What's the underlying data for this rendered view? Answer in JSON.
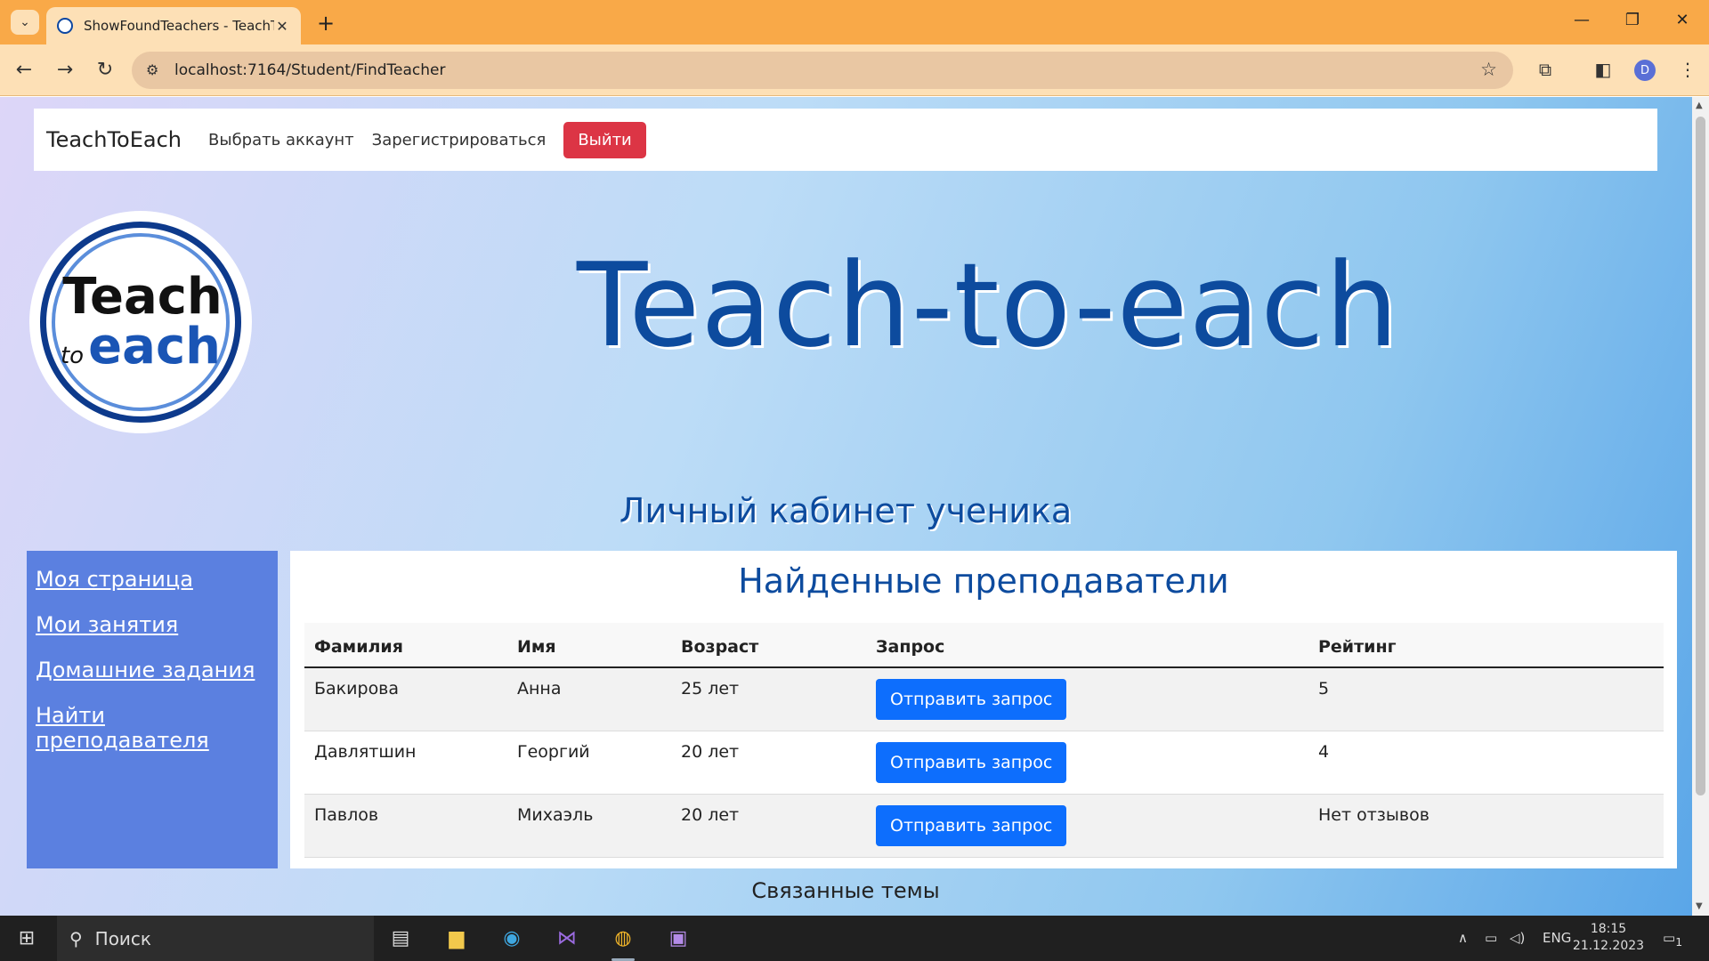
{
  "browser": {
    "tab_title": "ShowFoundTeachers - TeachToE",
    "tab_close": "✕",
    "new_tab": "+",
    "url": "localhost:7164/Student/FindTeacher",
    "profile_letter": "D"
  },
  "site_nav": {
    "brand": "TeachToEach",
    "links": [
      "Выбрать аккаунт",
      "Зарегистрироваться"
    ],
    "logout": "Выйти"
  },
  "logo": {
    "teach": "Teach",
    "to": "to",
    "each": "each"
  },
  "hero_title": "Teach-to-each",
  "cabinet_title": "Личный кабинет ученика",
  "sidebar": {
    "items": [
      "Моя страница",
      "Мои занятия",
      "Домашние задания",
      "Найти преподавателя"
    ]
  },
  "main": {
    "heading": "Найденные преподаватели",
    "columns": [
      "Фамилия",
      "Имя",
      "Возраст",
      "Запрос",
      "Рейтинг"
    ],
    "rows": [
      {
        "surname": "Бакирова",
        "name": "Анна",
        "age": "25 лет",
        "action": "Отправить запрос",
        "rating": "5"
      },
      {
        "surname": "Давлятшин",
        "name": "Георгий",
        "age": "20 лет",
        "action": "Отправить запрос",
        "rating": "4"
      },
      {
        "surname": "Павлов",
        "name": "Михаэль",
        "age": "20 лет",
        "action": "Отправить запрос",
        "rating": "Нет отзывов"
      }
    ]
  },
  "related_title": "Связанные темы",
  "taskbar": {
    "search_placeholder": "Поиск",
    "lang": "ENG",
    "time": "18:15",
    "date": "21.12.2023",
    "notif_count": "1"
  },
  "colors": {
    "brand_blue": "#0d4b9e",
    "logout_red": "#dc3545",
    "button_blue": "#0d6efd",
    "sidebar_blue": "#5b80e0",
    "chrome_orange": "#f9a948"
  }
}
